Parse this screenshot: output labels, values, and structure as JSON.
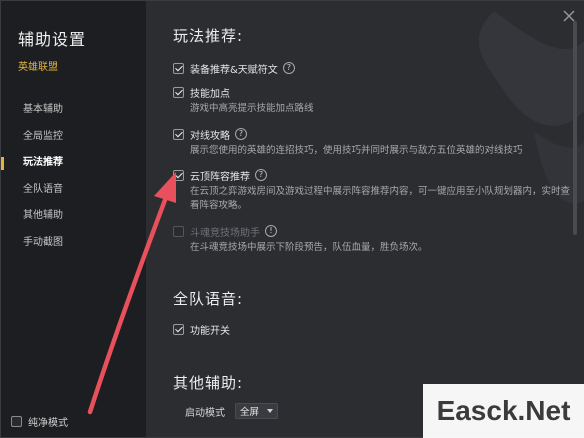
{
  "sidebar": {
    "title": "辅助设置",
    "game": "英雄联盟",
    "items": [
      {
        "label": "基本辅助"
      },
      {
        "label": "全局监控"
      },
      {
        "label": "玩法推荐",
        "active": true
      },
      {
        "label": "全队语音"
      },
      {
        "label": "其他辅助"
      },
      {
        "label": "手动截图"
      }
    ],
    "pure_mode": "纯净模式"
  },
  "main": {
    "section_play": "玩法推荐:",
    "options": [
      {
        "label": "装备推荐&天赋符文",
        "checked": true,
        "help": "?",
        "desc": ""
      },
      {
        "label": "技能加点",
        "checked": true,
        "help": "",
        "desc": "游戏中高亮提示技能加点路线"
      },
      {
        "label": "对线攻略",
        "checked": true,
        "help": "?",
        "desc": "展示您使用的英雄的连招技巧，使用技巧并同时展示与敌方五位英雄的对线技巧"
      },
      {
        "label": "云顶阵容推荐",
        "checked": true,
        "help": "?",
        "desc": "在云顶之弈游戏房间及游戏过程中展示阵容推荐内容，可一键应用至小队规划器内，实时查看阵容攻略。"
      },
      {
        "label": "斗魂竞技场助手",
        "checked": false,
        "disabled": true,
        "help": "!",
        "desc": "在斗魂竞技场中展示下阶段预告，队伍血量，胜负场次。"
      }
    ],
    "section_voice": "全队语音:",
    "voice_toggle": "功能开关",
    "section_other": "其他辅助:",
    "start_mode_label": "启动模式",
    "start_mode_value": "全屏"
  },
  "icons": {
    "close": "close-icon",
    "help": "help-icon",
    "info": "info-icon",
    "caret": "chevron-down-icon"
  },
  "colors": {
    "accent": "#e2b340",
    "arrow": "#e8505b"
  },
  "watermark": "Easck.Net"
}
